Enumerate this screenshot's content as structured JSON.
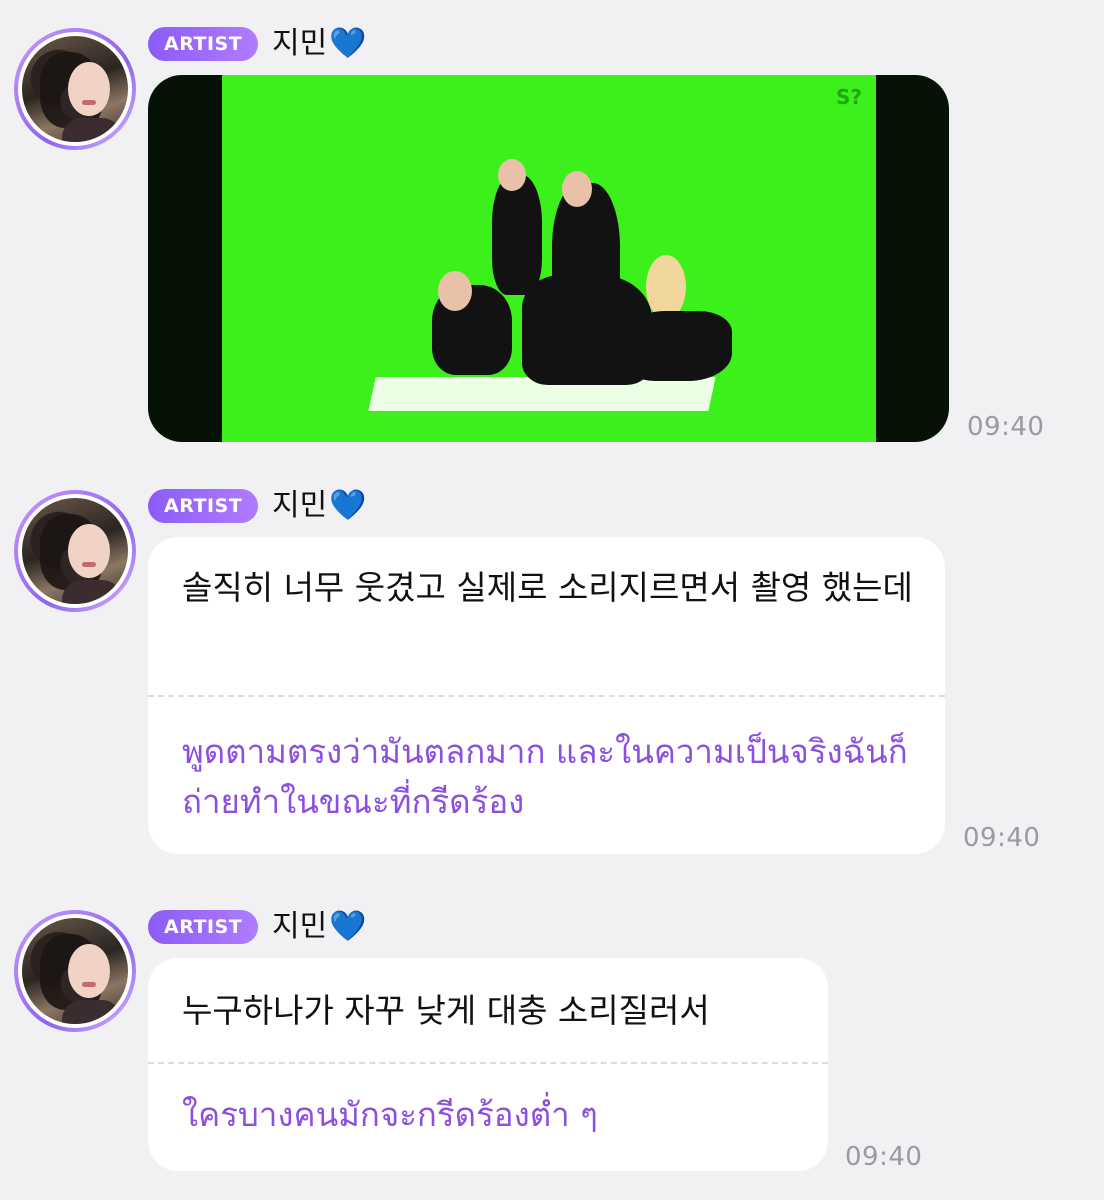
{
  "messages": [
    {
      "badge": "ARTIST",
      "name": "지민",
      "emoji": "💙",
      "type": "image",
      "time": "09:40"
    },
    {
      "badge": "ARTIST",
      "name": "지민",
      "emoji": "💙",
      "type": "text",
      "text": "솔직히 너무 웃겼고 실제로 소리지르면서 촬영 했는데",
      "translation": "พูดตามตรงว่ามันตลกมาก และในความเป็นจริงฉันก็ถ่ายทำในขณะที่กรีดร้อง",
      "time": "09:40"
    },
    {
      "badge": "ARTIST",
      "name": "지민",
      "emoji": "💙",
      "type": "text",
      "text": "누구하나가 자꾸 낮게 대충 소리질러서",
      "translation": "ใครบางคนมักจะกรีดร้องต่ำ ๆ",
      "time": "09:40"
    }
  ]
}
